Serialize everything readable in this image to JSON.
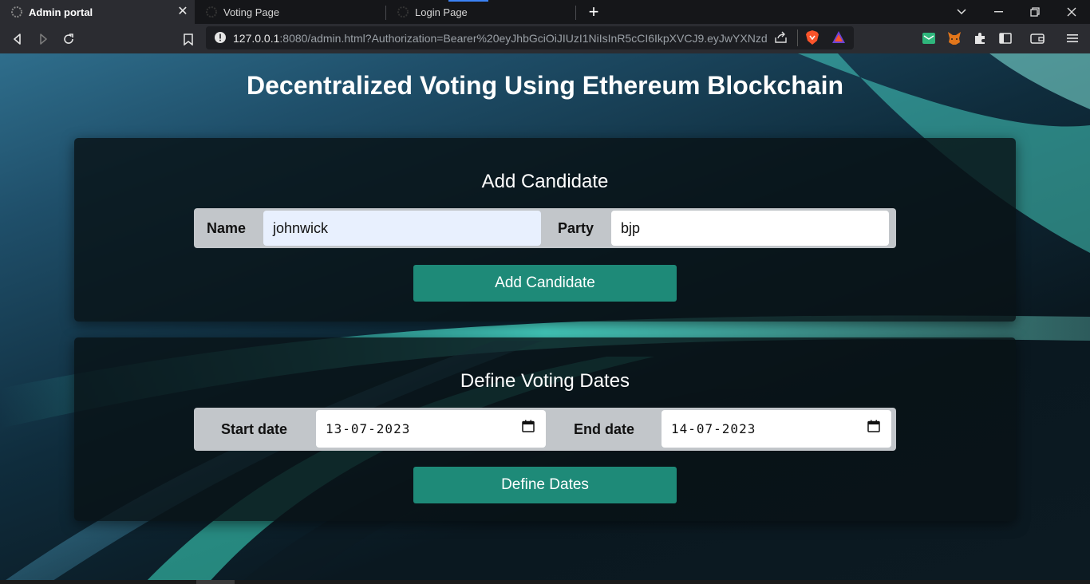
{
  "browser": {
    "tabs": [
      {
        "label": "Admin portal",
        "active": true
      },
      {
        "label": "Voting Page",
        "active": false
      },
      {
        "label": "Login Page",
        "active": false
      }
    ],
    "url_host": "127.0.0.1",
    "url_rest": ":8080/admin.html?Authorization=Bearer%20eyJhbGciOiJIUzI1NiIsInR5cCI6IkpXVCJ9.eyJwYXNzd29...",
    "icons": [
      "back-icon",
      "forward-icon",
      "reload-icon",
      "bookmark-icon",
      "info-icon",
      "share-icon",
      "brave-shield-icon",
      "brave-rewards-icon",
      "mail-extension-icon",
      "metamask-icon",
      "extensions-puzzle-icon",
      "sidebar-icon",
      "wallet-icon",
      "menu-icon"
    ],
    "brand_color": "#fb542b"
  },
  "header": {
    "title": "Decentralized Voting Using Ethereum Blockchain"
  },
  "add_candidate": {
    "title": "Add Candidate",
    "name_label": "Name",
    "name_value": "johnwick",
    "party_label": "Party",
    "party_value": "bjp",
    "button_label": "Add Candidate"
  },
  "voting_dates": {
    "title": "Define Voting Dates",
    "start_label": "Start date",
    "start_value": "13-07-2023",
    "end_label": "End date",
    "end_value": "14-07-2023",
    "button_label": "Define Dates"
  },
  "colors": {
    "accent": "#1e8a78",
    "panel": "#081216",
    "field_row": "#c2c6ca"
  }
}
